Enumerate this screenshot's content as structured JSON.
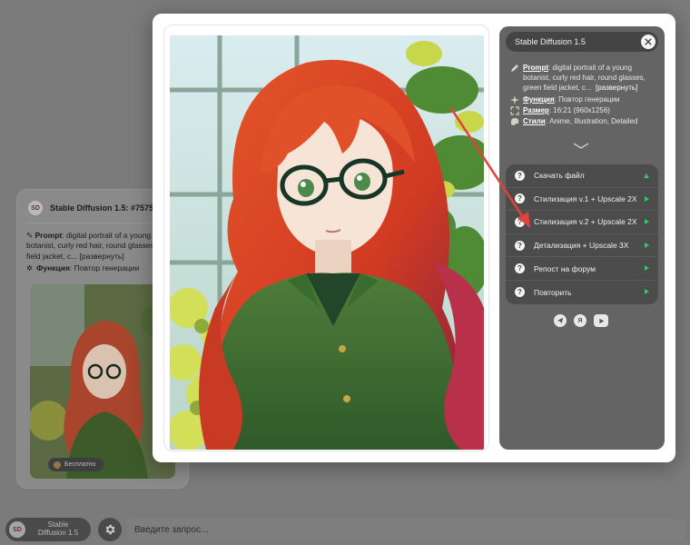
{
  "background_card": {
    "title": "Stable Diffusion 1.5: #7575",
    "logo_text": "SD",
    "prompt_key": "Prompt",
    "prompt_text": ": digital portrait of a young botanist, curly red hair, round glasses, green field jacket, c...",
    "expand_label": "[развернуть]",
    "function_key": "Функция",
    "function_value": ": Повтор генерации",
    "badge": "Бесплатно"
  },
  "bottom_bar": {
    "model_label": "Stable\nDiffusion 1.5",
    "model_logo": "SD",
    "prompt_placeholder": "Введите запрос..."
  },
  "panel": {
    "title": "Stable Diffusion 1.5",
    "info": {
      "prompt_key": "Prompt",
      "prompt_value": ": digital portrait of a young botanist, curly red hair, round glasses, green field jacket, c...",
      "expand_label": "[развернуть]",
      "function_key": "Функция",
      "function_value": ": Повтор генерации",
      "size_key": "Размер",
      "size_value": ": 16:21 (960x1256)",
      "styles_key": "Стили",
      "styles_value": ": Anime, Illustration, Detailed"
    },
    "actions": [
      {
        "label": "Скачать файл",
        "icon": "download"
      },
      {
        "label": "Стилизация v.1 + Upscale 2X",
        "icon": "play"
      },
      {
        "label": "Стилизация v.2 + Upscale 2X",
        "icon": "play"
      },
      {
        "label": "Детализация + Upscale 3X",
        "icon": "play"
      },
      {
        "label": "Репост на форум",
        "icon": "play"
      },
      {
        "label": "Повторить",
        "icon": "play"
      }
    ],
    "help_glyph": "?",
    "socials": [
      "telegram-icon",
      "yandex-icon",
      "youtube-icon"
    ],
    "yandex_glyph": "Я"
  },
  "colors": {
    "accent_green": "#38c46a",
    "arrow_red": "#e0433b",
    "panel_bg": "#646464"
  }
}
